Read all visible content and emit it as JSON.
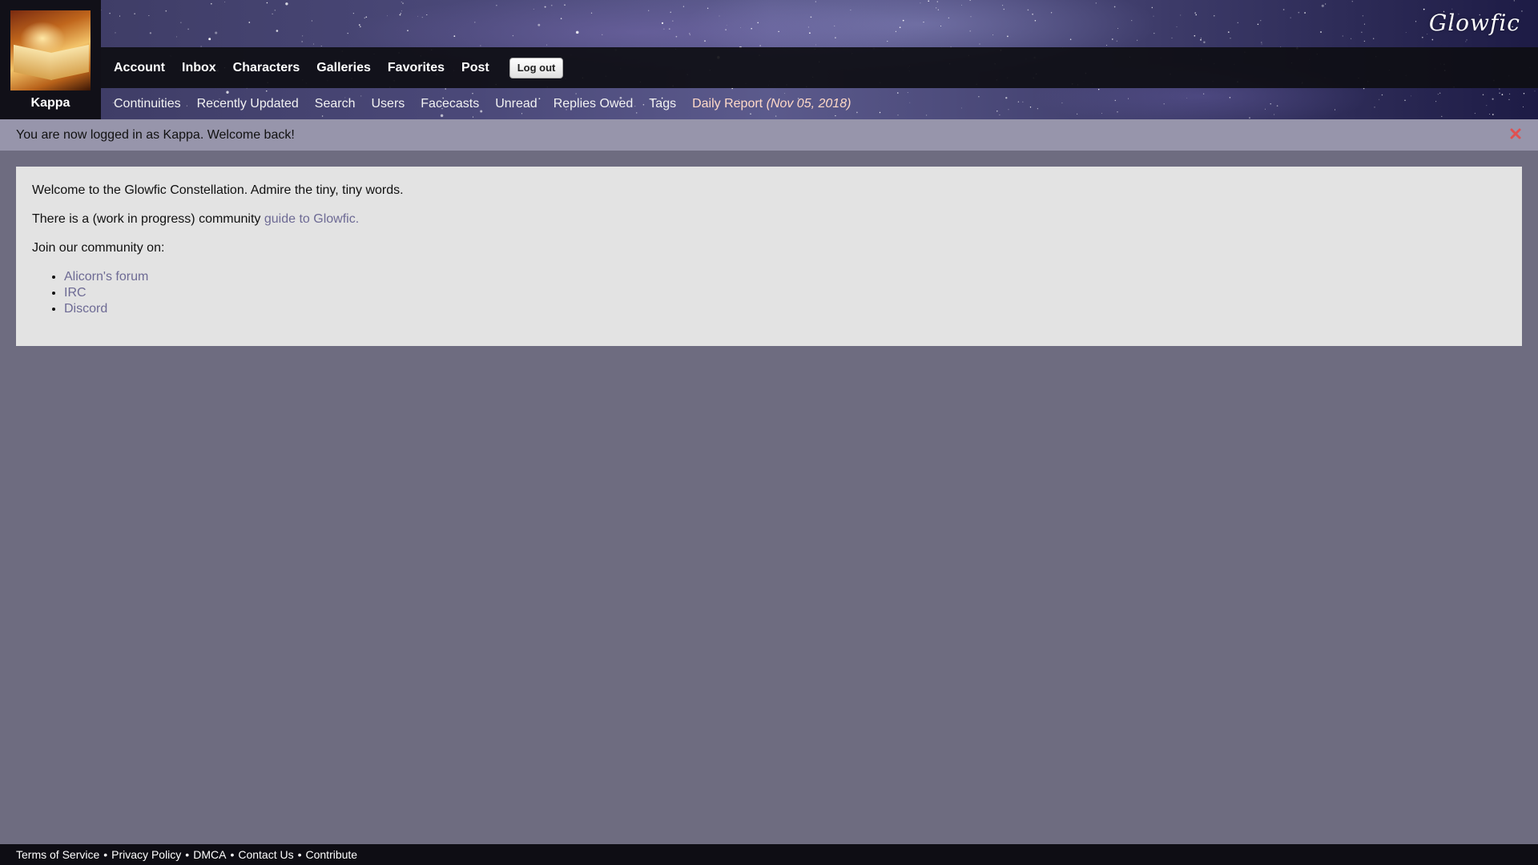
{
  "user": {
    "name": "Kappa"
  },
  "site": {
    "logo_text": "Glowfic"
  },
  "nav_primary": {
    "items": [
      "Account",
      "Inbox",
      "Characters",
      "Galleries",
      "Favorites",
      "Post"
    ],
    "logout_label": "Log out"
  },
  "nav_secondary": {
    "items": [
      "Continuities",
      "Recently Updated",
      "Search",
      "Users",
      "Facecasts",
      "Unread",
      "Replies Owed",
      "Tags"
    ],
    "daily_report": {
      "label": "Daily Report",
      "date": "(Nov 05, 2018)"
    }
  },
  "flash": {
    "message": "You are now logged in as Kappa. Welcome back!",
    "close_icon": "close-x-icon"
  },
  "content": {
    "welcome": "Welcome to the Glowfic Constellation. Admire the tiny, tiny words.",
    "guide_prefix": "There is a (work in progress) community ",
    "guide_link": "guide to Glowfic.",
    "join_text": "Join our community on:",
    "community_links": [
      "Alicorn's forum",
      "IRC",
      "Discord"
    ]
  },
  "footer": {
    "links": [
      "Terms of Service",
      "Privacy Policy",
      "DMCA",
      "Contact Us",
      "Contribute"
    ],
    "separator": "•"
  },
  "colors": {
    "page_bg": "#6e6c80",
    "flash_bg": "#9795ab",
    "content_bg": "#e3e3e3",
    "link": "#6d6a94",
    "nav_bar": "#0e0e14",
    "close_icon": "#e05050"
  }
}
